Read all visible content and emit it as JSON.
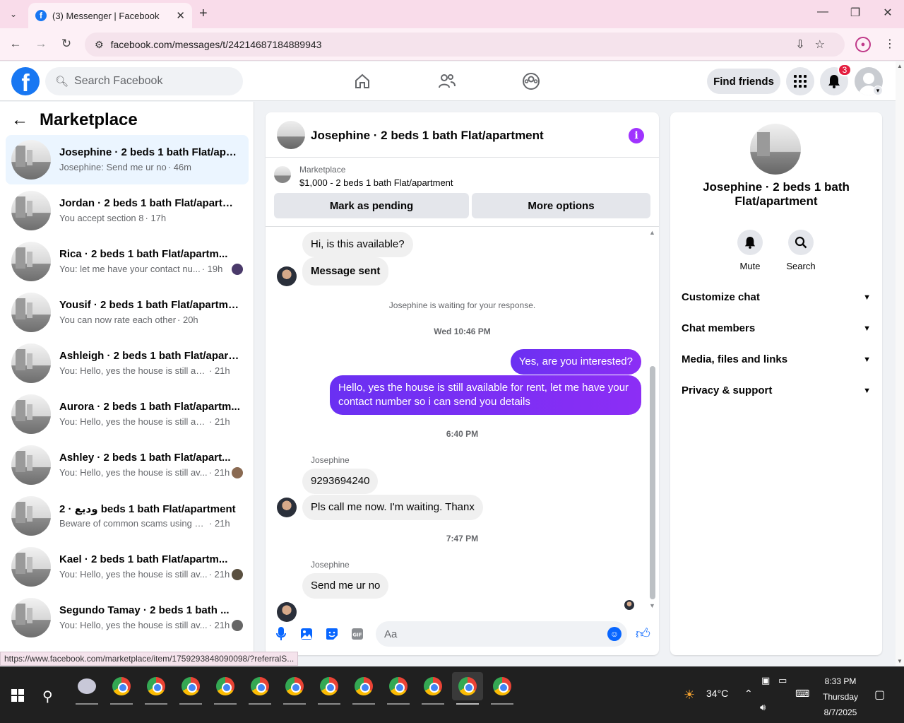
{
  "browser": {
    "tab_title": "(3) Messenger | Facebook",
    "url": "facebook.com/messages/t/24214687184889943",
    "status_url": "https://www.facebook.com/marketplace/item/1759293848090098/?referralS..."
  },
  "fb_header": {
    "search_placeholder": "Search Facebook",
    "find_friends_label": "Find friends",
    "notification_count": "3"
  },
  "sidebar": {
    "title": "Marketplace",
    "conversations": [
      {
        "name": "Josephine · 2 beds 1 bath Flat/apar...",
        "snippet": "Josephine: Send me ur no",
        "time": "· 46m"
      },
      {
        "name": "Jordan · 2 beds 1 bath Flat/apartm...",
        "snippet": "You accept section 8",
        "time": "· 17h"
      },
      {
        "name": "Rica · 2 beds 1 bath Flat/apartm...",
        "snippet": "You: let me have your contact nu...",
        "time": "· 19h"
      },
      {
        "name": "Yousif · 2 beds 1 bath Flat/apartme...",
        "snippet": "You can now rate each other",
        "time": "· 20h"
      },
      {
        "name": "Ashleigh · 2 beds 1 bath Flat/apart...",
        "snippet": "You: Hello, yes the house is still avail...",
        "time": "· 21h"
      },
      {
        "name": "Aurora · 2 beds 1 bath Flat/apartm...",
        "snippet": "You: Hello, yes the house is still avail...",
        "time": "· 21h"
      },
      {
        "name": "Ashley · 2 beds 1 bath Flat/apart...",
        "snippet": "You: Hello, yes the house is still av...",
        "time": "· 21h"
      },
      {
        "name": "وديع · 2 beds 1 bath Flat/apartment",
        "snippet": "Beware of common scams using pay...",
        "time": "· 21h"
      },
      {
        "name": "Kael · 2 beds 1 bath Flat/apartm...",
        "snippet": "You: Hello, yes the house is still av...",
        "time": "· 21h"
      },
      {
        "name": "Segundo Tamay · 2 beds 1 bath ...",
        "snippet": "You: Hello, yes the house is still av...",
        "time": "· 21h"
      }
    ]
  },
  "chat": {
    "title": "Josephine · 2 beds 1 bath Flat/apartment",
    "listing_source": "Marketplace",
    "listing_desc": "$1,000 - 2 beds 1 bath Flat/apartment",
    "btn_pending": "Mark as pending",
    "btn_more": "More options",
    "messages": {
      "m1": "Hi, is this available?",
      "m2": "Message sent",
      "waiting": "Josephine is waiting for your response.",
      "ts1": "Wed 10:46 PM",
      "m3": "Yes, are you interested?",
      "m4": "Hello, yes the house is still available for rent, let me have your contact number so i can send you details",
      "ts2": "6:40 PM",
      "sender1": "Josephine",
      "m5": "9293694240",
      "m6": "Pls call me now. I'm waiting. Thanx",
      "ts3": "7:47 PM",
      "sender2": "Josephine",
      "m7": "Send me ur no"
    },
    "composer_placeholder": "Aa"
  },
  "info_panel": {
    "name": "Josephine · 2 beds 1 bath Flat/apartment",
    "mute_label": "Mute",
    "search_label": "Search",
    "sections": [
      "Customize chat",
      "Chat members",
      "Media, files and links",
      "Privacy & support"
    ]
  },
  "taskbar": {
    "temperature": "34°C",
    "time": "8:33 PM",
    "day": "Thursday",
    "date": "8/7/2025"
  },
  "colors": {
    "brand": "#1877f2",
    "outgoing_bubble": "#7b2ff7",
    "active_conv": "#ebf5ff"
  }
}
